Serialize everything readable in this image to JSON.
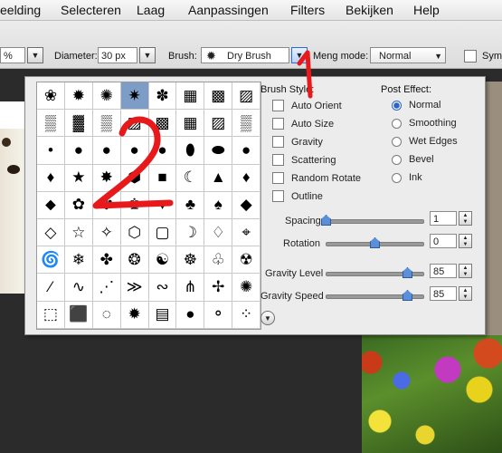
{
  "menubar": {
    "items": [
      "eelding",
      "Selecteren",
      "Laag",
      "Aanpassingen",
      "Filters",
      "Bekijken",
      "Help"
    ]
  },
  "options": {
    "pct_value": "%",
    "diameter_label": "Diameter:",
    "diameter_value": "30 px",
    "brush_label": "Brush:",
    "brush_value": "Dry Brush",
    "mode_label": "Meng mode:",
    "mode_value": "Normal",
    "sym_label": "Sym"
  },
  "brush_grid": {
    "rows": [
      [
        "❀",
        "✹",
        "✺",
        "✷",
        "✽",
        "▦",
        "▩",
        "▨"
      ],
      [
        "▒",
        "▓",
        "▒",
        "▨",
        "▩",
        "▦",
        "▨",
        "▒"
      ],
      [
        "•",
        "●",
        "●",
        "●",
        "●",
        "⬮",
        "⬬",
        "●"
      ],
      [
        "♦",
        "★",
        "✸",
        "⬢",
        "■",
        "☾",
        "▲",
        "♦"
      ],
      [
        "⬥",
        "✿",
        "✾",
        "♚",
        "♥",
        "♣",
        "♠",
        "◆"
      ],
      [
        "◇",
        "☆",
        "✧",
        "⬡",
        "▢",
        "☽",
        "♢",
        "⌖"
      ],
      [
        "🌀",
        "❄",
        "✤",
        "❂",
        "☯",
        "☸",
        "♧",
        "☢"
      ],
      [
        "⁄",
        "∿",
        "⋰",
        "≫",
        "∾",
        "⋔",
        "✢",
        "✺"
      ],
      [
        "⬚",
        "⬛",
        "◌",
        "✹",
        "▤",
        "●",
        "⚬",
        "⁘"
      ]
    ],
    "selected": "0,3"
  },
  "brush_style": {
    "title": "Brush Style:",
    "items": [
      "Auto Orient",
      "Auto Size",
      "Gravity",
      "Scattering",
      "Random Rotate",
      "Outline"
    ]
  },
  "post_effect": {
    "title": "Post Effect:",
    "items": [
      "Normal",
      "Smoothing",
      "Wet Edges",
      "Bevel",
      "Ink"
    ],
    "selected": "Normal"
  },
  "sliders": {
    "spacing": {
      "label": "Spacing",
      "value": "1"
    },
    "rotation": {
      "label": "Rotation",
      "value": "0"
    },
    "gravity_level": {
      "label": "Gravity Level",
      "value": "85"
    },
    "gravity_speed": {
      "label": "Gravity Speed",
      "value": "85"
    }
  },
  "colors": {
    "annotation": "#e8191a",
    "selection": "#7d9cc6",
    "accent": "#2a63c9"
  }
}
